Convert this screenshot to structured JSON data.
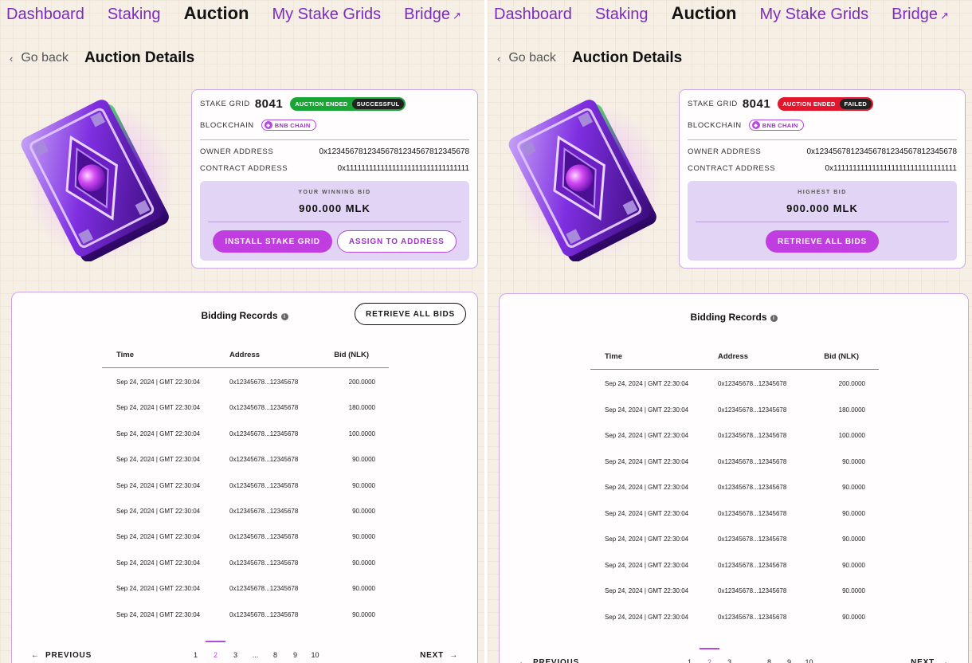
{
  "nav": {
    "items": [
      {
        "label": "Dashboard"
      },
      {
        "label": "Staking"
      },
      {
        "label": "Auction"
      },
      {
        "label": "My Stake Grids"
      },
      {
        "label": "Bridge"
      }
    ],
    "active": "Auction"
  },
  "back": {
    "label": "Go back"
  },
  "title": "Auction Details",
  "colors": {
    "accent": "#c03ee0",
    "success": "#18a534",
    "failed": "#e3162b"
  },
  "icons": [
    "chevron-left-icon",
    "external-link-icon",
    "info-icon",
    "bnb-chain-icon",
    "arrow-left-icon",
    "arrow-right-icon"
  ],
  "panels": [
    {
      "stake_grid_label": "STAKE GRID",
      "stake_grid_number": "8041",
      "status_left": "AUCTION ENDED",
      "status_right": "SUCCESSFUL",
      "blockchain_label": "BLOCKCHAIN",
      "chain_name": "BNB CHAIN",
      "owner_label": "OWNER ADDRESS",
      "owner_address": "0x12345678123456781234567812345678",
      "contract_label": "CONTRACT ADDRESS",
      "contract_address": "0x11111111111111111111111111111111",
      "bid_label": "YOUR WINNING BID",
      "bid_value": "900.000 MLK",
      "actions": [
        "INSTALL STAKE GRID",
        "ASSIGN TO ADDRESS"
      ]
    },
    {
      "stake_grid_label": "STAKE GRID",
      "stake_grid_number": "8041",
      "status_left": "AUCTION ENDED",
      "status_right": "FAILED",
      "blockchain_label": "BLOCKCHAIN",
      "chain_name": "BNB CHAIN",
      "owner_label": "OWNER ADDRESS",
      "owner_address": "0x12345678123456781234567812345678",
      "contract_label": "CONTRACT ADDRESS",
      "contract_address": "0x11111111111111111111111111111111",
      "bid_label": "HIGHEST BID",
      "bid_value": "900.000 MLK",
      "actions": [
        "RETRIEVE ALL BIDS"
      ]
    }
  ],
  "records": {
    "title": "Bidding Records",
    "retrieve_label": "RETRIEVE ALL BIDS",
    "columns": [
      "Time",
      "Address",
      "Bid (NLK)"
    ],
    "rows": [
      [
        "Sep 24, 2024 | GMT 22:30:04",
        "0x12345678...12345678",
        "200.0000"
      ],
      [
        "Sep 24, 2024 | GMT 22:30:04",
        "0x12345678...12345678",
        "180.0000"
      ],
      [
        "Sep 24, 2024 | GMT 22:30:04",
        "0x12345678...12345678",
        "100.0000"
      ],
      [
        "Sep 24, 2024 | GMT 22:30:04",
        "0x12345678...12345678",
        "90.0000"
      ],
      [
        "Sep 24, 2024 | GMT 22:30:04",
        "0x12345678...12345678",
        "90.0000"
      ],
      [
        "Sep 24, 2024 | GMT 22:30:04",
        "0x12345678...12345678",
        "90.0000"
      ],
      [
        "Sep 24, 2024 | GMT 22:30:04",
        "0x12345678...12345678",
        "90.0000"
      ],
      [
        "Sep 24, 2024 | GMT 22:30:04",
        "0x12345678...12345678",
        "90.0000"
      ],
      [
        "Sep 24, 2024 | GMT 22:30:04",
        "0x12345678...12345678",
        "90.0000"
      ],
      [
        "Sep 24, 2024 | GMT 22:30:04",
        "0x12345678...12345678",
        "90.0000"
      ]
    ]
  },
  "pagination": {
    "previous": "PREVIOUS",
    "next": "NEXT",
    "pages": [
      "1",
      "2",
      "3",
      "...",
      "8",
      "9",
      "10"
    ],
    "current": "2"
  }
}
